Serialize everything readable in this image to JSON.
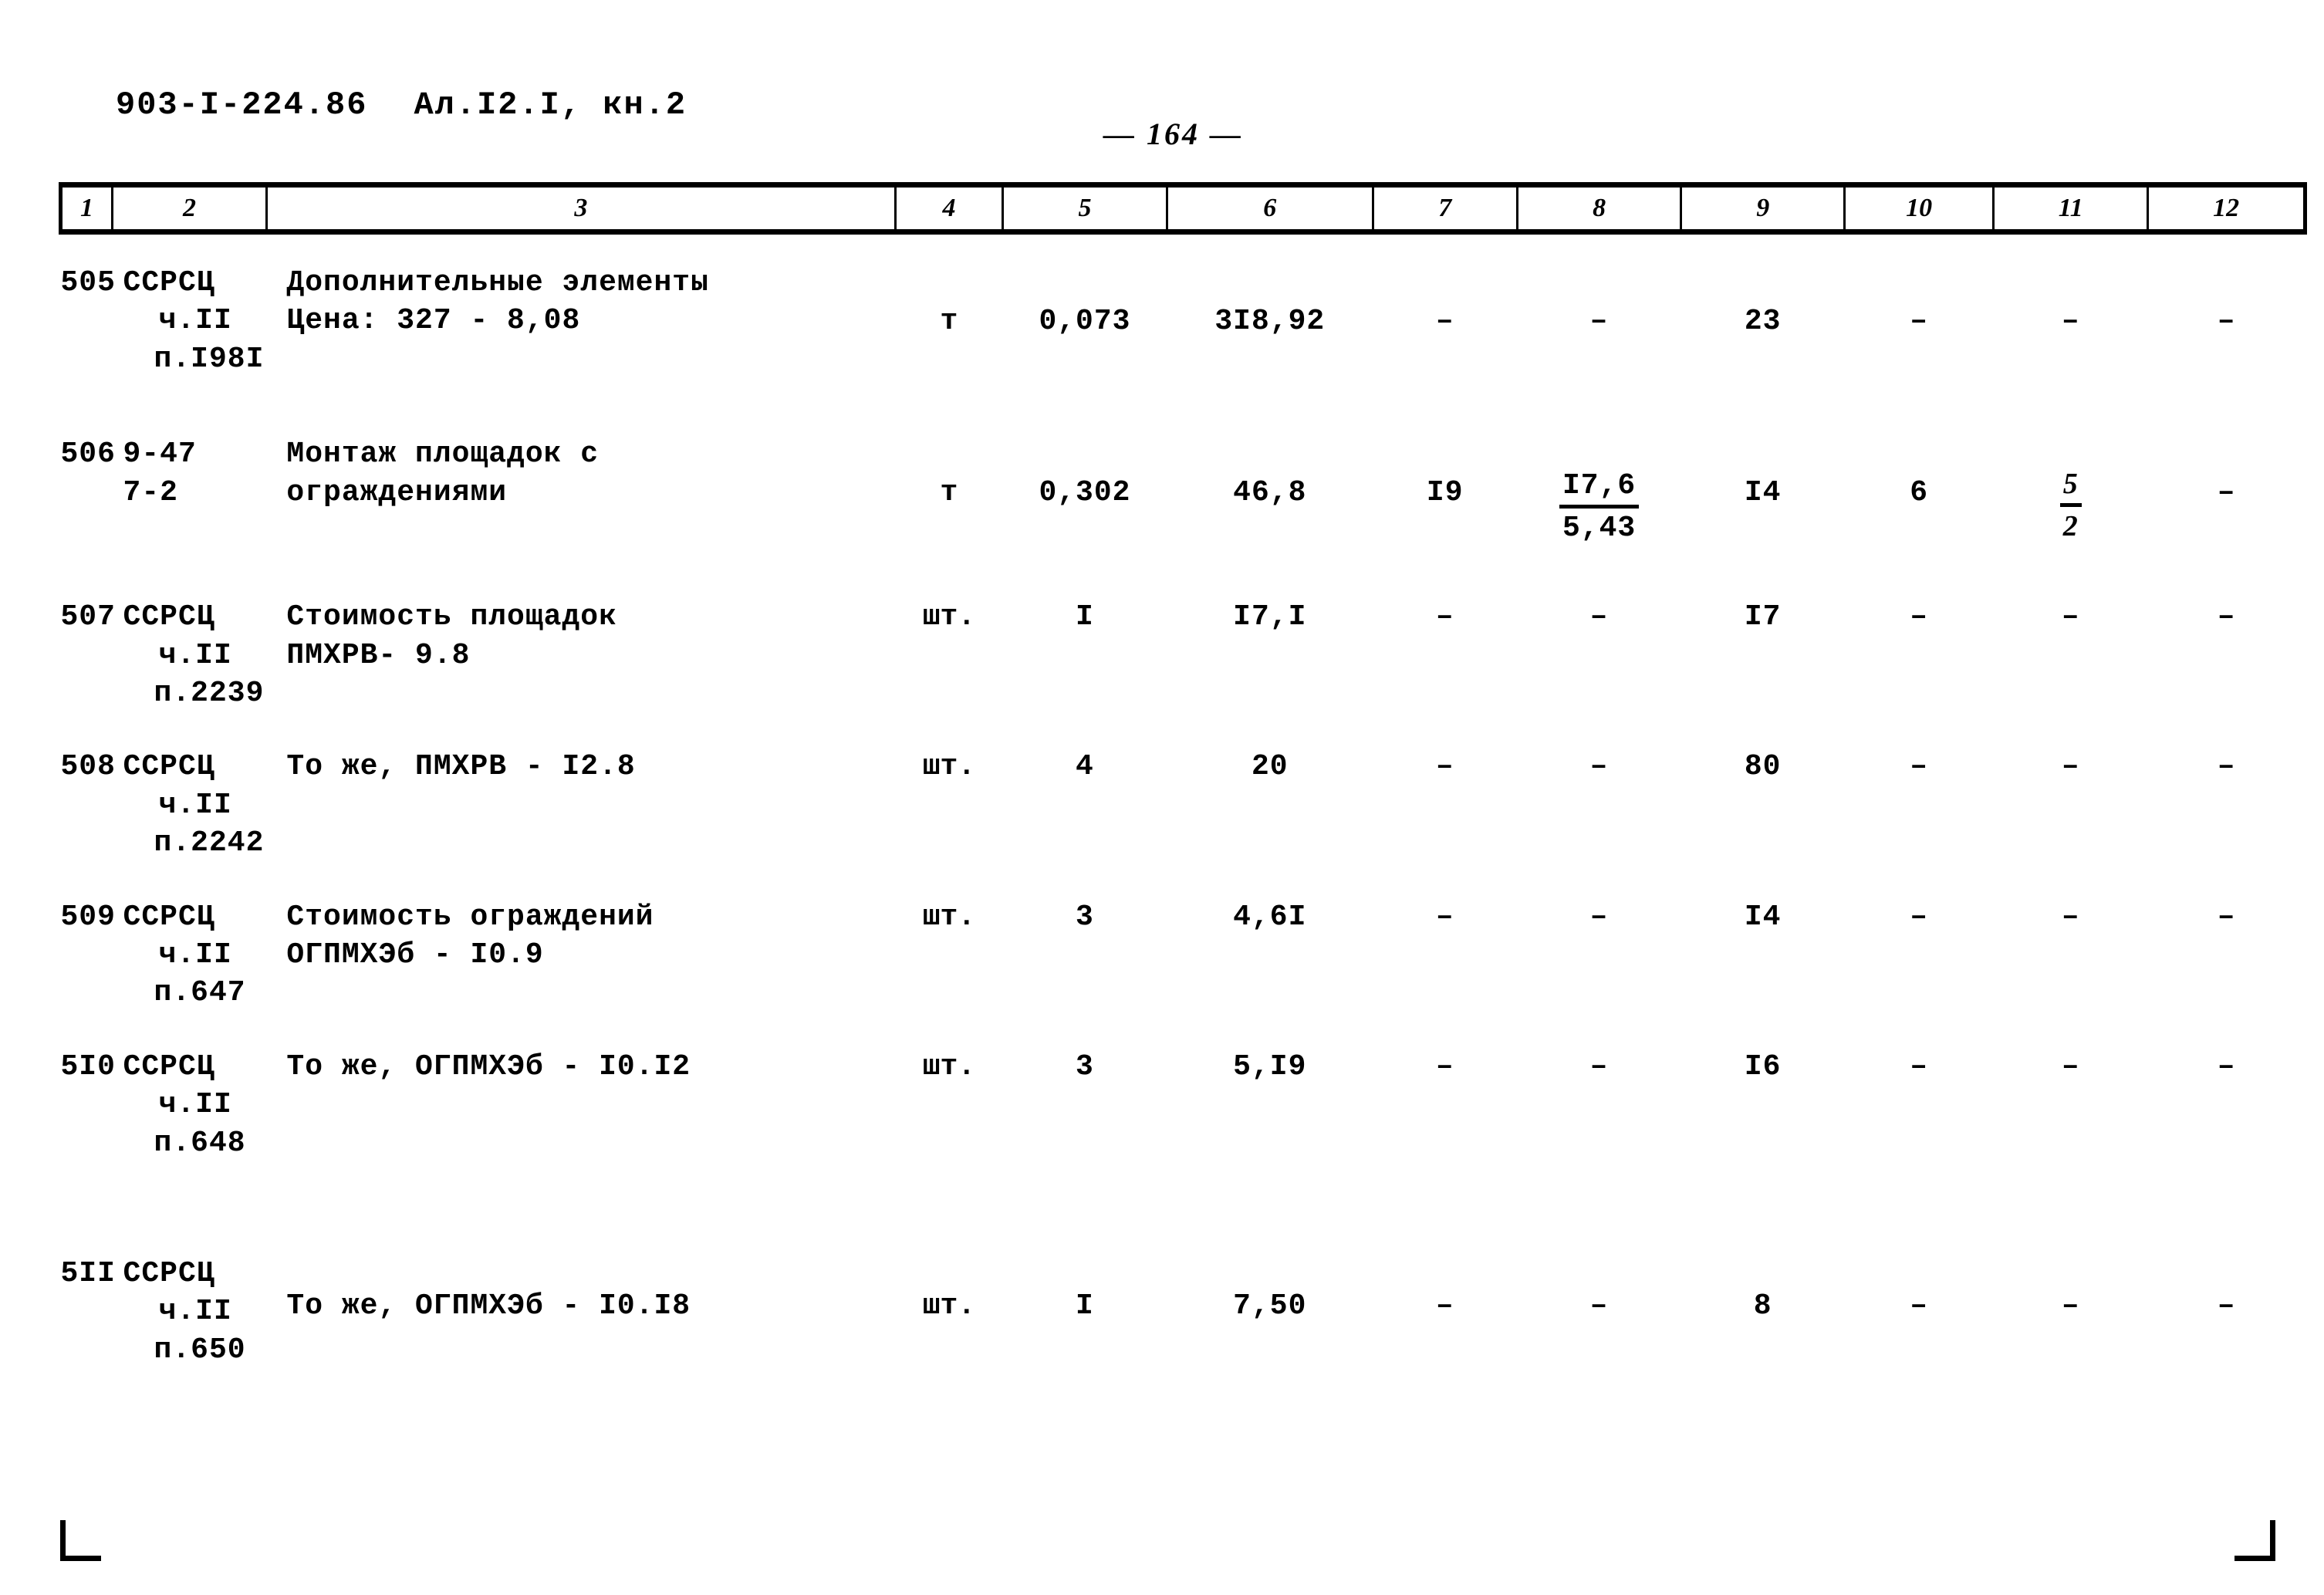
{
  "header": {
    "document_code": "903-I-224.86",
    "album_ref": "Ал.I2.I, кн.2",
    "page_label": "— 164 —"
  },
  "table": {
    "column_headers": [
      "1",
      "2",
      "3",
      "4",
      "5",
      "6",
      "7",
      "8",
      "9",
      "10",
      "11",
      "12"
    ],
    "rows": [
      {
        "num": "505",
        "code_lines": [
          "ССРСЦ",
          "ч.II",
          "п.I98I"
        ],
        "desc_lines": [
          "Дополнительные элементы",
          "Цена: 327 - 8,08"
        ],
        "unit": "т",
        "c5": "0,073",
        "c6": "3I8,92",
        "c7": "–",
        "c8": "–",
        "c9": "23",
        "c10": "–",
        "c11": "–",
        "c12": "–"
      },
      {
        "num": "506",
        "code_lines": [
          "9-47",
          "7-2"
        ],
        "desc_lines": [
          "Монтаж площадок с",
          "ограждениями"
        ],
        "unit": "т",
        "c5": "0,302",
        "c6": "46,8",
        "c7": "I9",
        "c8_num": "I7,6",
        "c8_den": "5,43",
        "c9": "I4",
        "c10": "6",
        "c11_num": "5",
        "c11_den": "2",
        "c12": "–"
      },
      {
        "num": "507",
        "code_lines": [
          "ССРСЦ",
          "ч.II",
          "п.2239"
        ],
        "desc_lines": [
          "Стоимость площадок",
          "ПМХРВ- 9.8"
        ],
        "unit": "шт.",
        "c5": "I",
        "c6": "I7,I",
        "c7": "–",
        "c8": "–",
        "c9": "I7",
        "c10": "–",
        "c11": "–",
        "c12": "–"
      },
      {
        "num": "508",
        "code_lines": [
          "ССРСЦ",
          "ч.II",
          "п.2242"
        ],
        "desc_lines": [
          "То же, ПМХРВ - I2.8"
        ],
        "unit": "шт.",
        "c5": "4",
        "c6": "20",
        "c7": "–",
        "c8": "–",
        "c9": "80",
        "c10": "–",
        "c11": "–",
        "c12": "–"
      },
      {
        "num": "509",
        "code_lines": [
          "ССРСЦ",
          "ч.II",
          "п.647"
        ],
        "desc_lines": [
          "Стоимость ограждений",
          "ОГПМХЭб - I0.9"
        ],
        "unit": "шт.",
        "c5": "3",
        "c6": "4,6I",
        "c7": "–",
        "c8": "–",
        "c9": "I4",
        "c10": "–",
        "c11": "–",
        "c12": "–"
      },
      {
        "num": "5I0",
        "code_lines": [
          "ССРСЦ",
          "ч.II",
          "п.648"
        ],
        "desc_lines": [
          "То же, ОГПМХЭб - I0.I2"
        ],
        "unit": "шт.",
        "c5": "3",
        "c6": "5,I9",
        "c7": "–",
        "c8": "–",
        "c9": "I6",
        "c10": "–",
        "c11": "–",
        "c12": "–"
      },
      {
        "num": "5II",
        "code_lines": [
          "ССРСЦ",
          "ч.II",
          "п.650"
        ],
        "desc_lines": [
          "То же, ОГПМХЭб - I0.I8"
        ],
        "unit": "шт.",
        "c5": "I",
        "c6": "7,50",
        "c7": "–",
        "c8": "–",
        "c9": "8",
        "c10": "–",
        "c11": "–",
        "c12": "–"
      }
    ]
  }
}
